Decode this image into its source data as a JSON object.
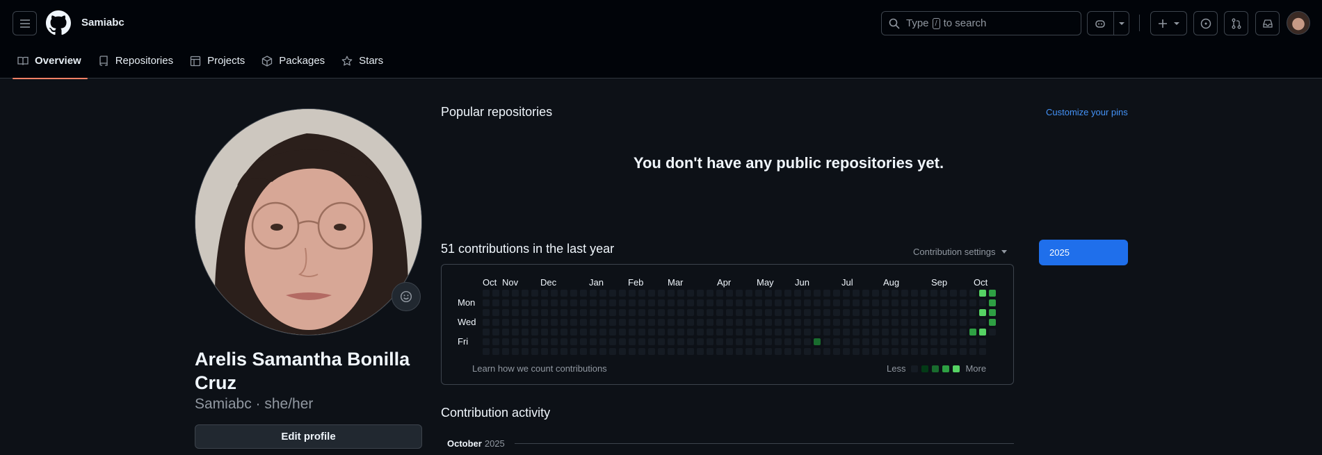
{
  "header": {
    "username": "Samiabc",
    "search_prefix": "Type",
    "search_key": "/",
    "search_suffix": "to search",
    "icons": [
      "hamburger-icon",
      "github-logo",
      "search-icon",
      "copilot-icon",
      "plus-icon",
      "issue-icon",
      "pull-request-icon",
      "inbox-icon"
    ]
  },
  "tabs": [
    {
      "label": "Overview",
      "icon": "book-icon",
      "active": true
    },
    {
      "label": "Repositories",
      "icon": "repo-icon",
      "active": false
    },
    {
      "label": "Projects",
      "icon": "table-icon",
      "active": false
    },
    {
      "label": "Packages",
      "icon": "package-icon",
      "active": false
    },
    {
      "label": "Stars",
      "icon": "star-icon",
      "active": false
    }
  ],
  "profile": {
    "full_name": "Arelis Samantha Bonilla Cruz",
    "handle": "Samiabc · she/her",
    "edit_label": "Edit profile"
  },
  "popular": {
    "title": "Popular repositories",
    "customize_label": "Customize your pins",
    "empty_message": "You don't have any public repositories yet."
  },
  "contributions": {
    "title": "51 contributions in the last year",
    "settings_label": "Contribution settings",
    "year_label": "2025",
    "months": [
      "Oct",
      "Nov",
      "Dec",
      "Jan",
      "Feb",
      "Mar",
      "Apr",
      "May",
      "Jun",
      "Jul",
      "Aug",
      "Sep",
      "Oct"
    ],
    "weekdays": [
      "Mon",
      "Wed",
      "Fri"
    ],
    "learn_label": "Learn how we count contributions",
    "legend_less": "Less",
    "legend_more": "More",
    "level_colors": [
      "#151b23",
      "#033a16",
      "#196c2e",
      "#2ea043",
      "#56d364"
    ]
  },
  "activity": {
    "title": "Contribution activity",
    "month": "October",
    "year": "2025"
  }
}
